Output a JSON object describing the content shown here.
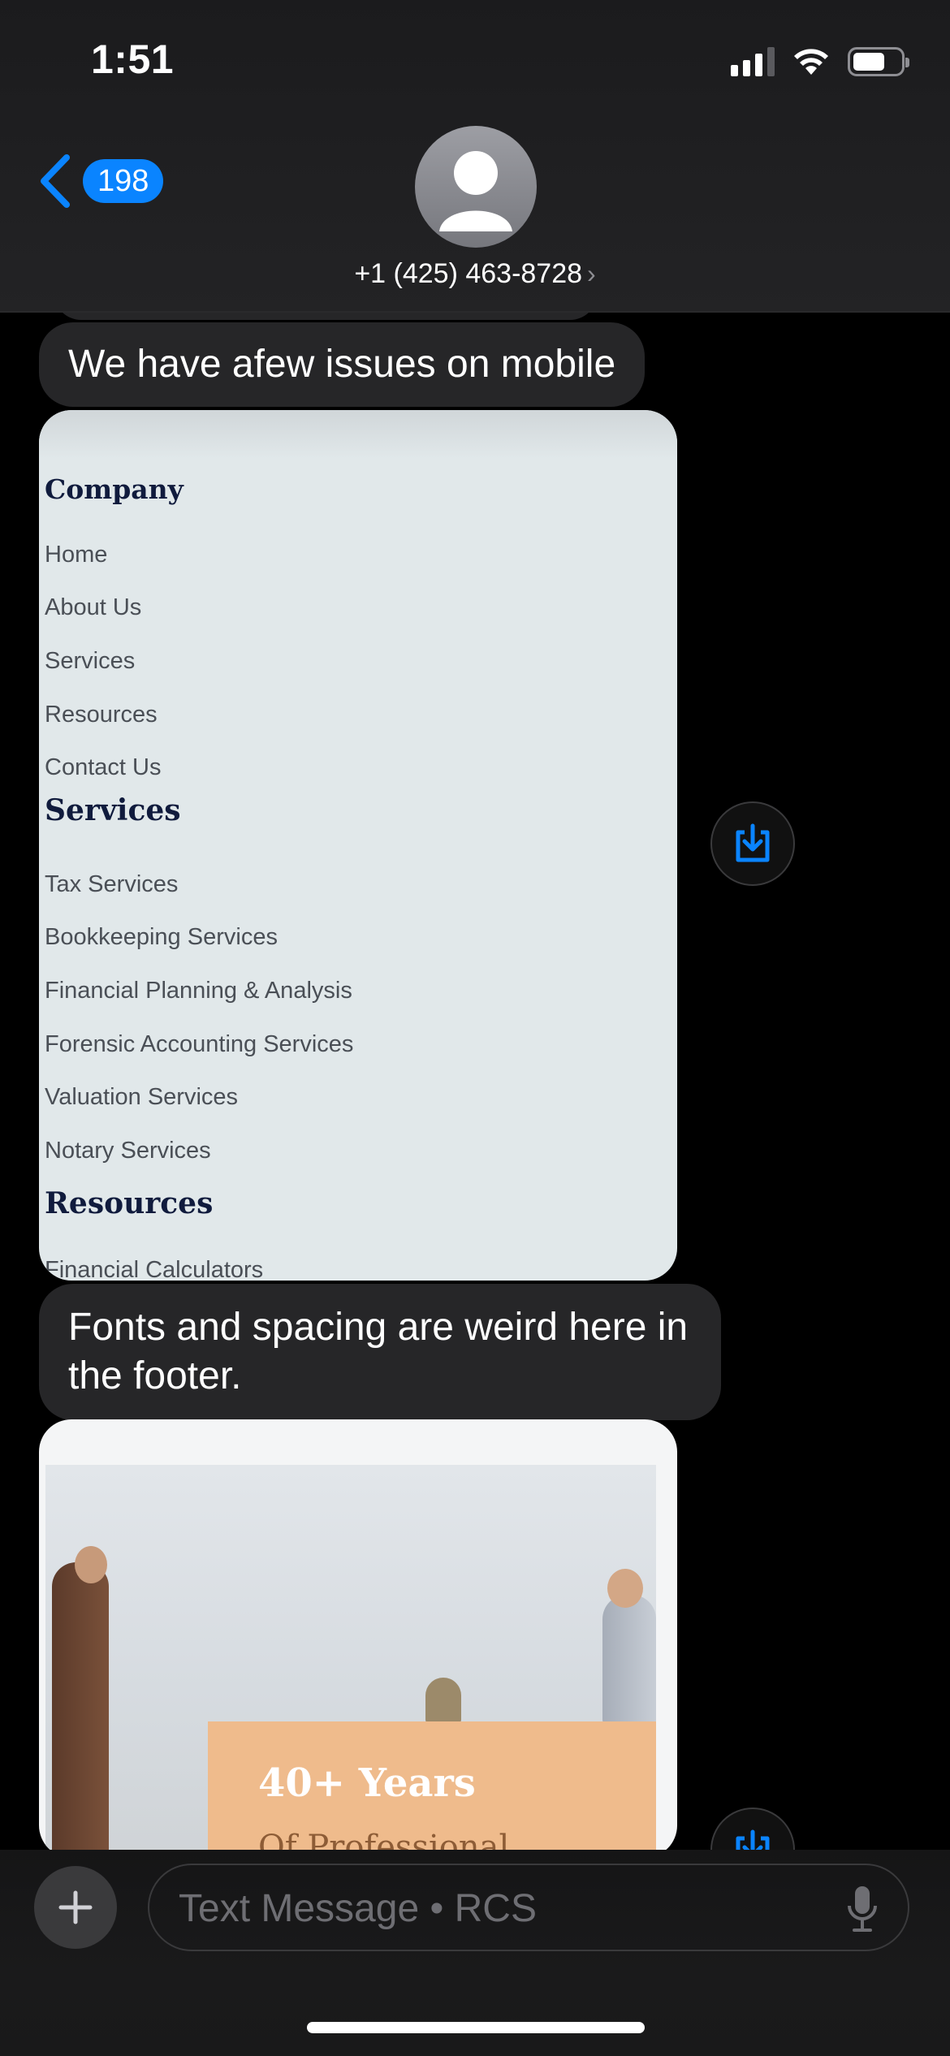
{
  "status_bar": {
    "time": "1:51"
  },
  "header": {
    "back_count": "198",
    "contact_number": "+1 (425) 463-8728"
  },
  "messages": {
    "m1": "We have afew issues on mobile",
    "m2": "Fonts and spacing are weird here in the footer."
  },
  "screenshot1": {
    "company_heading": "Company",
    "company_links": [
      "Home",
      "About Us",
      "Services",
      "Resources",
      "Contact Us"
    ],
    "services_heading": "Services",
    "services_links": [
      "Tax Services",
      "Bookkeeping Services",
      "Financial Planning & Analysis",
      "Forensic Accounting Services",
      "Valuation Services",
      "Notary Services"
    ],
    "resources_heading": "Resources",
    "resources_links": [
      "Financial Calculators"
    ]
  },
  "screenshot2": {
    "banner_title": "40+ Years",
    "banner_sub": "Of Professional Experience"
  },
  "composer": {
    "placeholder": "Text Message • RCS"
  },
  "colors": {
    "accent": "#0a84ff",
    "bubble": "#262628",
    "background": "#000000"
  },
  "icons": [
    "back-chevron-icon",
    "contact-avatar-icon",
    "save-image-icon",
    "plus-icon",
    "microphone-icon",
    "wifi-icon",
    "signal-icon",
    "battery-icon"
  ]
}
